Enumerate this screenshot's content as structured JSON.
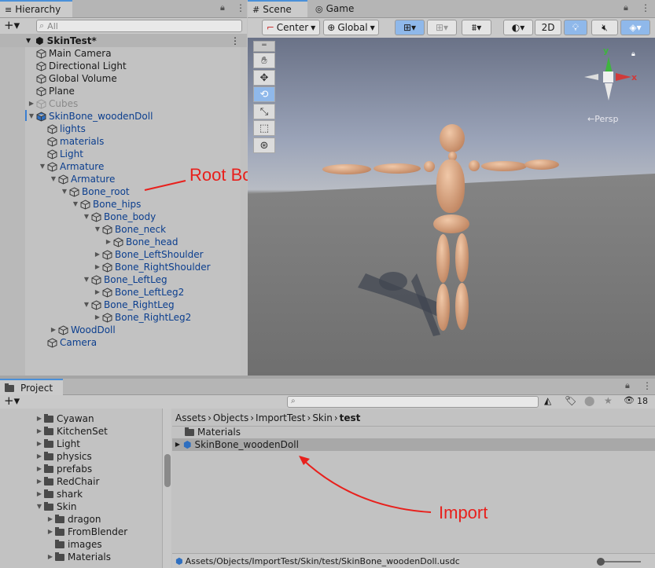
{
  "hierarchy": {
    "tab": "Hierarchy",
    "search_placeholder": "All",
    "scene": "SkinTest*",
    "items": [
      {
        "label": "Main Camera",
        "depth": 1,
        "arrow": false,
        "color": "normal"
      },
      {
        "label": "Directional Light",
        "depth": 1,
        "arrow": false,
        "color": "normal"
      },
      {
        "label": "Global Volume",
        "depth": 1,
        "arrow": false,
        "color": "normal"
      },
      {
        "label": "Plane",
        "depth": 1,
        "arrow": false,
        "color": "normal"
      },
      {
        "label": "Cubes",
        "depth": 1,
        "arrow": "right",
        "color": "grey"
      },
      {
        "label": "SkinBone_woodenDoll",
        "depth": 1,
        "arrow": "down",
        "color": "blue"
      },
      {
        "label": "lights",
        "depth": 2,
        "arrow": false,
        "color": "blue"
      },
      {
        "label": "materials",
        "depth": 2,
        "arrow": false,
        "color": "blue"
      },
      {
        "label": "Light",
        "depth": 2,
        "arrow": false,
        "color": "blue"
      },
      {
        "label": "Armature",
        "depth": 2,
        "arrow": "down",
        "color": "blue"
      },
      {
        "label": "Armature",
        "depth": 3,
        "arrow": "down",
        "color": "blue"
      },
      {
        "label": "Bone_root",
        "depth": 4,
        "arrow": "down",
        "color": "blue"
      },
      {
        "label": "Bone_hips",
        "depth": 5,
        "arrow": "down",
        "color": "blue"
      },
      {
        "label": "Bone_body",
        "depth": 6,
        "arrow": "down",
        "color": "blue"
      },
      {
        "label": "Bone_neck",
        "depth": 7,
        "arrow": "down",
        "color": "blue"
      },
      {
        "label": "Bone_head",
        "depth": 8,
        "arrow": "right",
        "color": "blue"
      },
      {
        "label": "Bone_LeftShoulder",
        "depth": 7,
        "arrow": "right",
        "color": "blue"
      },
      {
        "label": "Bone_RightShoulder",
        "depth": 7,
        "arrow": "right",
        "color": "blue"
      },
      {
        "label": "Bone_LeftLeg",
        "depth": 6,
        "arrow": "down",
        "color": "blue"
      },
      {
        "label": "Bone_LeftLeg2",
        "depth": 7,
        "arrow": "right",
        "color": "blue"
      },
      {
        "label": "Bone_RightLeg",
        "depth": 6,
        "arrow": "down",
        "color": "blue"
      },
      {
        "label": "Bone_RightLeg2",
        "depth": 7,
        "arrow": "right",
        "color": "blue"
      },
      {
        "label": "WoodDoll",
        "depth": 3,
        "arrow": "right",
        "color": "blue"
      },
      {
        "label": "Camera",
        "depth": 2,
        "arrow": false,
        "color": "blue"
      }
    ]
  },
  "annotations": {
    "root_bone": "Root Bone",
    "import": "Import"
  },
  "scene": {
    "tab_scene": "Scene",
    "tab_game": "Game",
    "pivot": "Center",
    "space": "Global",
    "mode_2d": "2D",
    "persp": "←Persp",
    "gizmo_y": "y",
    "gizmo_x": "x"
  },
  "project": {
    "tab": "Project",
    "badge_count": "18",
    "folders": [
      {
        "label": "Cyawan",
        "indent": 1,
        "arrow": "right"
      },
      {
        "label": "KitchenSet",
        "indent": 1,
        "arrow": "right"
      },
      {
        "label": "Light",
        "indent": 1,
        "arrow": "right"
      },
      {
        "label": "physics",
        "indent": 1,
        "arrow": "right"
      },
      {
        "label": "prefabs",
        "indent": 1,
        "arrow": "right"
      },
      {
        "label": "RedChair",
        "indent": 1,
        "arrow": "right"
      },
      {
        "label": "shark",
        "indent": 1,
        "arrow": "right"
      },
      {
        "label": "Skin",
        "indent": 1,
        "arrow": "down"
      },
      {
        "label": "dragon",
        "indent": 2,
        "arrow": "right"
      },
      {
        "label": "FromBlender",
        "indent": 2,
        "arrow": "right"
      },
      {
        "label": "images",
        "indent": 2,
        "arrow": false
      },
      {
        "label": "Materials",
        "indent": 2,
        "arrow": "right"
      }
    ],
    "breadcrumb": [
      "Assets",
      "Objects",
      "ImportTest",
      "Skin",
      "test"
    ],
    "assets": [
      {
        "label": "Materials",
        "type": "folder"
      },
      {
        "label": "SkinBone_woodenDoll",
        "type": "model"
      }
    ],
    "status_path": "Assets/Objects/ImportTest/Skin/test/SkinBone_woodenDoll.usdc"
  },
  "colors": {
    "accent": "#4a90d9",
    "annotation": "#e8201c",
    "hierarchy_blue": "#0b3e8e"
  }
}
